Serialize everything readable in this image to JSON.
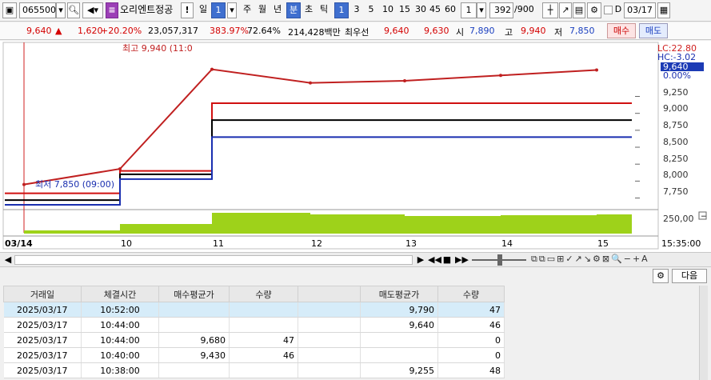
{
  "toolbar": {
    "code": "065500",
    "stock_name": "오리엔트정공",
    "period_unit": "일",
    "period_value": "1",
    "periods": [
      "주",
      "월",
      "년",
      "분",
      "초",
      "틱"
    ],
    "minutes": [
      "1",
      "3",
      "5",
      "10",
      "15",
      "30",
      "45",
      "60"
    ],
    "count_value": "1",
    "display_count": "392",
    "display_total": "/900",
    "date_value": "03/17",
    "d_label": "D"
  },
  "quote": {
    "price": "9,640",
    "change_arrow": "▲",
    "change": "1,620",
    "change_pct": "+20.20%",
    "volume": "23,057,317",
    "vol_ratio": "383.97%",
    "turnover": "72.64%",
    "amount": "214,428백만",
    "best_sell_label": "최우선",
    "best_sell": "9,640",
    "best_buy": "9,630",
    "open_label": "시",
    "open": "7,890",
    "high_label": "고",
    "high": "9,940",
    "low_label": "저",
    "low": "7,850",
    "buy_btn": "매수",
    "sell_btn": "매도"
  },
  "chart": {
    "high_marker": "최고 9,940 (11:0",
    "low_marker": "최저 7,850 (09:00)",
    "lc_label": "LC:22.80",
    "hc_label": "HC:-3.02",
    "current_price": "9,640",
    "current_pct": "0.00%",
    "y_ticks": [
      "9,250",
      "9,000",
      "8,750",
      "8,500",
      "8,250",
      "8,000",
      "7,750"
    ],
    "vol_tick": "250,00",
    "x_labels": [
      "03/14",
      "10",
      "11",
      "12",
      "13",
      "14",
      "15"
    ],
    "time_label": "15:35:00",
    "colors": {
      "price": "#c02020",
      "up_line": "#d01010",
      "mid_line": "#000000",
      "low_line": "#1a2fb0",
      "volume": "#9ed21a"
    }
  },
  "chart_data": {
    "type": "line",
    "title": "",
    "x": [
      "03/14",
      "10",
      "11",
      "12",
      "13",
      "14",
      "15"
    ],
    "series": [
      {
        "values": [
          7950,
          8180,
          9650,
          9450,
          9480,
          9560,
          9640
        ]
      }
    ],
    "ylim": [
      7650,
      10000
    ],
    "lines": [
      {
        "values": [
          7820,
          8150,
          9150,
          9150,
          9150,
          9150,
          9150
        ]
      },
      {
        "values": [
          7720,
          8100,
          8900,
          8900,
          8900,
          8900,
          8900
        ]
      },
      {
        "values": [
          7650,
          8030,
          8650,
          8650,
          8650,
          8650,
          8650
        ]
      }
    ]
  },
  "table": {
    "headers": [
      "거래일",
      "체결시간",
      "매수평균가",
      "수량",
      "",
      "매도평균가",
      "수량"
    ],
    "rows": [
      [
        "2025/03/17",
        "10:52:00",
        "",
        "",
        "",
        "9,790",
        "47"
      ],
      [
        "2025/03/17",
        "10:44:00",
        "",
        "",
        "",
        "9,640",
        "46"
      ],
      [
        "2025/03/17",
        "10:44:00",
        "9,680",
        "47",
        "",
        "",
        "0"
      ],
      [
        "2025/03/17",
        "10:40:00",
        "9,430",
        "46",
        "",
        "",
        "0"
      ],
      [
        "2025/03/17",
        "10:38:00",
        "",
        "",
        "",
        "9,255",
        "48"
      ]
    ],
    "next_btn": "다음"
  }
}
